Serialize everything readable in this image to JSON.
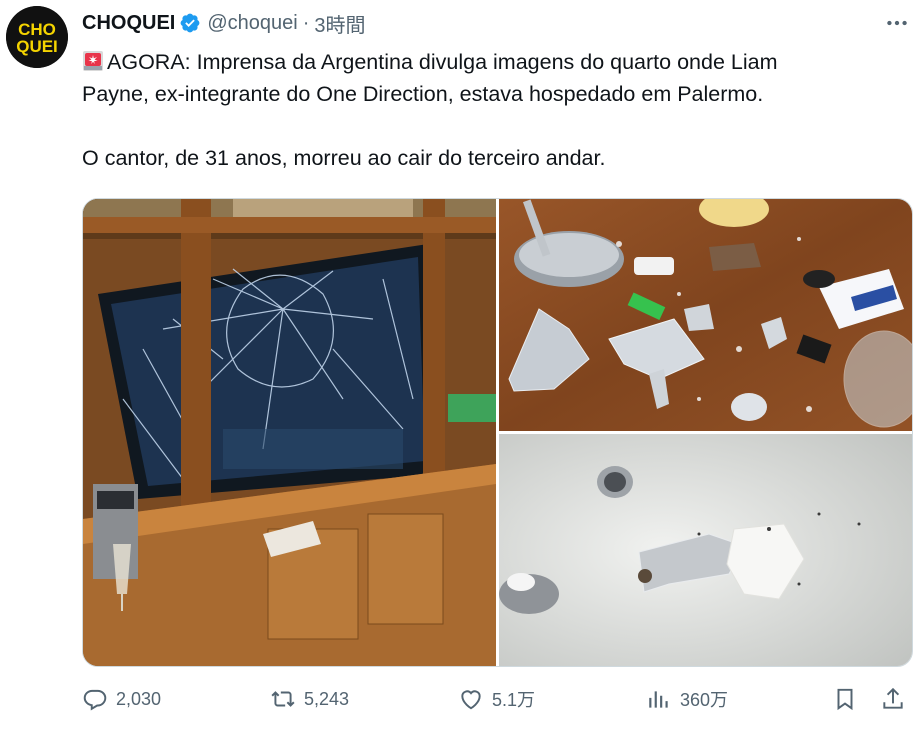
{
  "account": {
    "display_name": "CHOQUEI",
    "handle": "@choquei",
    "separator": "·",
    "time": "3時間",
    "avatar_text_top": "CHO",
    "avatar_text_bottom": "QUEI",
    "verified_color": "#1d9bf0"
  },
  "tweet": {
    "line1": "AGORA: Imprensa da Argentina divulga imagens do quarto onde Liam",
    "line2": "Payne, ex-integrante do One Direction, estava hospedado em Palermo.",
    "line3": "O cantor, de 31 anos, morreu ao cair do terceiro andar.",
    "emoji": "siren-icon"
  },
  "media": {
    "count": 3
  },
  "actions": {
    "replies": "2,030",
    "retweets": "5,243",
    "likes": "5.1万",
    "views": "360万"
  },
  "colors": {
    "text": "#0f1419",
    "secondary": "#536471",
    "border": "#cfd9de"
  }
}
